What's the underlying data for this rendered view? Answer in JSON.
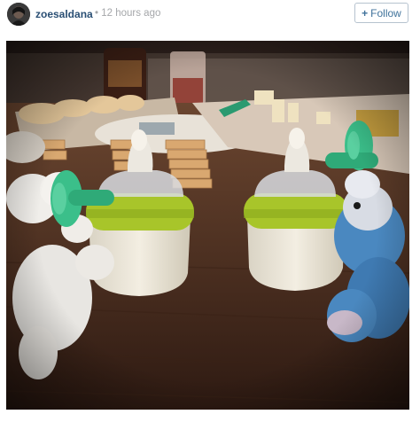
{
  "post": {
    "username": "zoesaldana",
    "timestamp": "• 12 hours ago"
  },
  "follow_button": {
    "label": "Follow",
    "icon": "plus-icon"
  },
  "photo": {
    "subject": "photo-image",
    "colors": {
      "table": "#5a3a28",
      "bottle_band": "#a8c52a",
      "pacifier": "#3bbf8a",
      "blue_toy": "#4a88c0"
    }
  }
}
